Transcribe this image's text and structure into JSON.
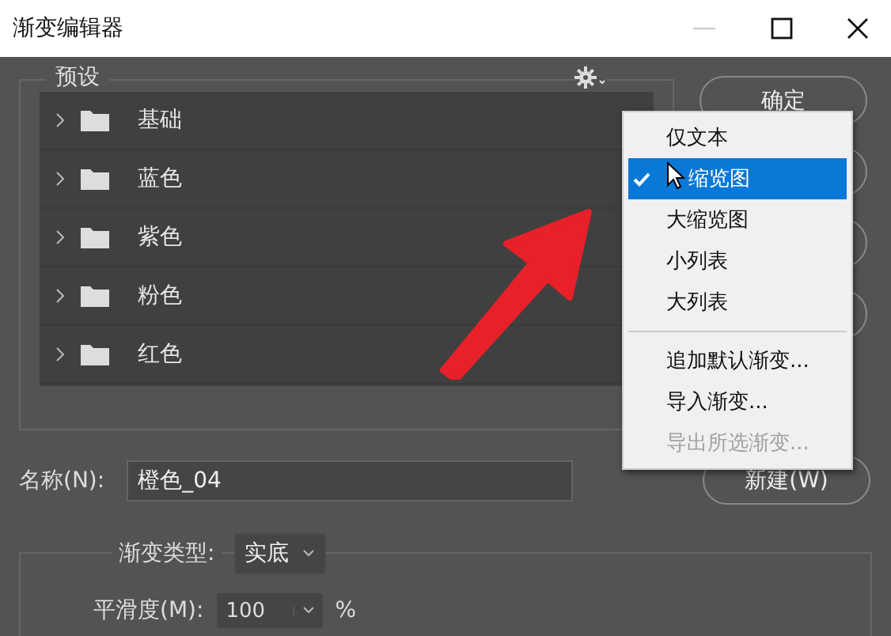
{
  "window": {
    "title": "渐变编辑器"
  },
  "presets": {
    "label": "预设",
    "folders": [
      {
        "name": "基础",
        "expanded": false
      },
      {
        "name": "蓝色",
        "expanded": false
      },
      {
        "name": "紫色",
        "expanded": false
      },
      {
        "name": "粉色",
        "expanded": false
      },
      {
        "name": "红色",
        "expanded": false
      }
    ]
  },
  "ok_button": "确定",
  "menu": {
    "items": [
      {
        "kind": "item",
        "label": "仅文本",
        "checked": false,
        "selected": false,
        "disabled": false
      },
      {
        "kind": "item",
        "label": "缩览图",
        "checked": true,
        "selected": true,
        "disabled": false,
        "hovered": true
      },
      {
        "kind": "item",
        "label": "大缩览图",
        "checked": false,
        "selected": false,
        "disabled": false
      },
      {
        "kind": "item",
        "label": "小列表",
        "checked": false,
        "selected": false,
        "disabled": false
      },
      {
        "kind": "item",
        "label": "大列表",
        "checked": false,
        "selected": false,
        "disabled": false
      },
      {
        "kind": "separator"
      },
      {
        "kind": "item",
        "label": "追加默认渐变...",
        "checked": false,
        "selected": false,
        "disabled": false
      },
      {
        "kind": "item",
        "label": "导入渐变...",
        "checked": false,
        "selected": false,
        "disabled": false
      },
      {
        "kind": "item",
        "label": "导出所选渐变...",
        "checked": false,
        "selected": false,
        "disabled": true
      }
    ]
  },
  "name": {
    "label": "名称(N):",
    "value": "橙色_04"
  },
  "new_button": "新建(W)",
  "gradient_type": {
    "label": "渐变类型:",
    "value": "实底"
  },
  "smoothness": {
    "label": "平滑度(M):",
    "value": "100",
    "unit": "%"
  }
}
